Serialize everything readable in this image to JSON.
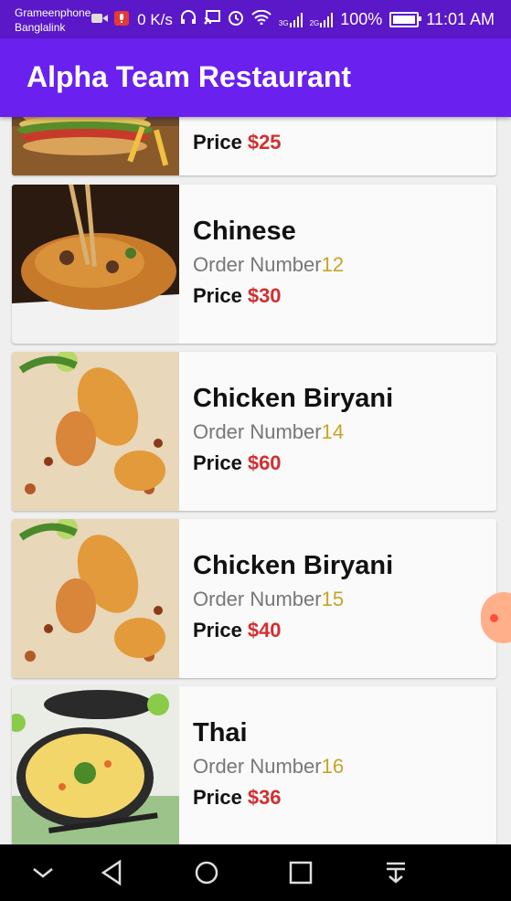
{
  "status_bar": {
    "carrier1": "Grameenphone",
    "carrier2": "Banglalink",
    "network_speed": "0 K/s",
    "network_3g": "3G",
    "network_2g": "2G",
    "battery": "100%",
    "time": "11:01 AM"
  },
  "app_bar": {
    "title": "Alpha Team Restaurant"
  },
  "labels": {
    "order_number": "Order Number",
    "price": "Price"
  },
  "items": [
    {
      "name": "",
      "order_number": "",
      "price": "$25",
      "image": "burger"
    },
    {
      "name": "Chinese",
      "order_number": "12",
      "price": "$30",
      "image": "noodles"
    },
    {
      "name": "Chicken Biryani",
      "order_number": "14",
      "price": "$60",
      "image": "biryani"
    },
    {
      "name": "Chicken Biryani",
      "order_number": "15",
      "price": "$40",
      "image": "biryani"
    },
    {
      "name": "Thai",
      "order_number": "16",
      "price": "$36",
      "image": "soup"
    }
  ],
  "colors": {
    "status_bar": "#5a18c9",
    "app_bar": "#6a20ee",
    "price": "#d32f2f",
    "order_num": "#c9a227"
  }
}
